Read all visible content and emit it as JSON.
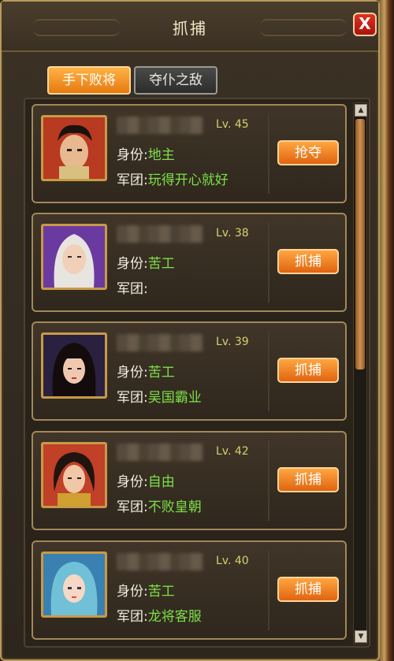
{
  "window": {
    "title": "抓捕",
    "close_label": "X"
  },
  "tabs": [
    {
      "label": "手下败将",
      "active": true
    },
    {
      "label": "夺仆之敌",
      "active": false
    }
  ],
  "labels": {
    "identity": "身份:",
    "legion": "军团:"
  },
  "players": [
    {
      "level": "Lv. 45",
      "identity": "地主",
      "legion": "玩得开心就好",
      "action": "抢夺",
      "avatar": "warrior-red-portrait"
    },
    {
      "level": "Lv. 38",
      "identity": "苦工",
      "legion": "",
      "action": "抓捕",
      "avatar": "white-hair-sage-portrait"
    },
    {
      "level": "Lv. 39",
      "identity": "苦工",
      "legion": "吴国霸业",
      "action": "抓捕",
      "avatar": "dark-hair-lady-portrait"
    },
    {
      "level": "Lv. 42",
      "identity": "自由",
      "legion": "不败皇朝",
      "action": "抓捕",
      "avatar": "red-warrior-lady-portrait"
    },
    {
      "level": "Lv. 40",
      "identity": "苦工",
      "legion": "龙将客服",
      "action": "抓捕",
      "avatar": "blue-hair-lady-portrait"
    }
  ],
  "colors": {
    "accent_orange": "#e77a10",
    "value_green": "#7ce048",
    "level_yellow": "#d8d070",
    "close_red": "#c8200f"
  }
}
